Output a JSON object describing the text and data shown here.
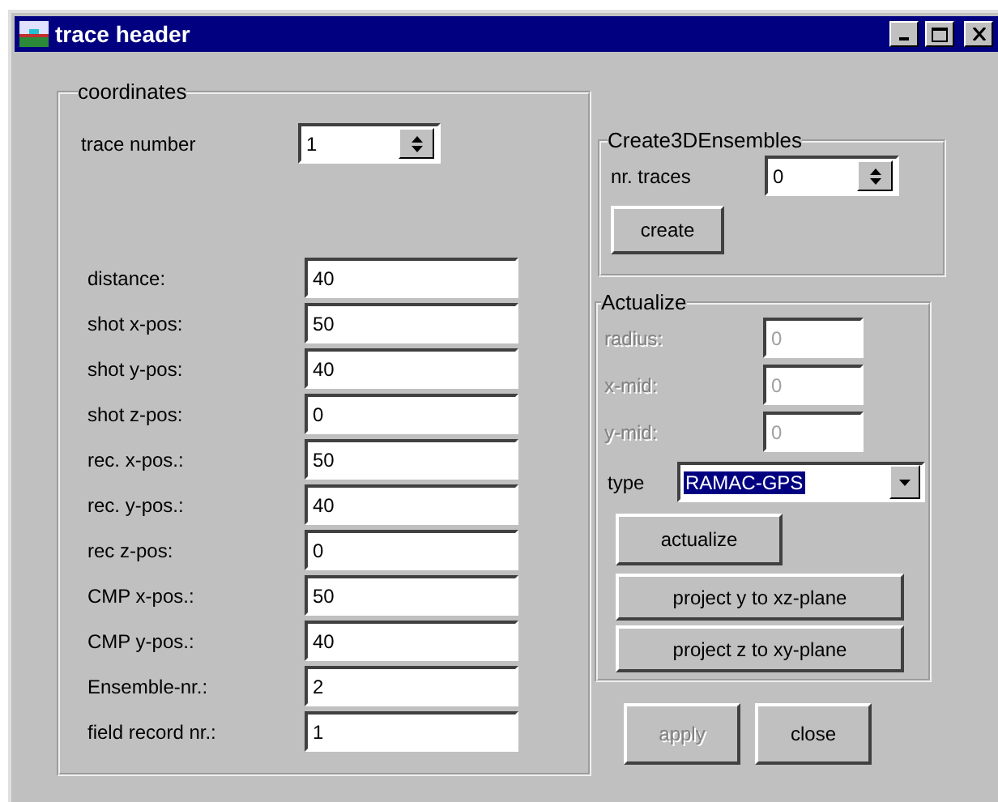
{
  "window": {
    "title": "trace header"
  },
  "coordinates": {
    "title": "coordinates",
    "trace_number": {
      "label": "trace number",
      "value": "1"
    },
    "fields": [
      {
        "label": "distance:",
        "value": "40"
      },
      {
        "label": "shot x-pos:",
        "value": "50"
      },
      {
        "label": "shot y-pos:",
        "value": "40"
      },
      {
        "label": "shot z-pos:",
        "value": "0"
      },
      {
        "label": "rec. x-pos.:",
        "value": "50"
      },
      {
        "label": "rec. y-pos.:",
        "value": "40"
      },
      {
        "label": "rec z-pos:",
        "value": "0"
      },
      {
        "label": "CMP x-pos.:",
        "value": "50"
      },
      {
        "label": "CMP y-pos.:",
        "value": "40"
      },
      {
        "label": "Ensemble-nr.:",
        "value": "2"
      },
      {
        "label": "field record nr.:",
        "value": "1"
      }
    ]
  },
  "create3d": {
    "title": "Create3DEnsembles",
    "nr_traces": {
      "label": "nr. traces",
      "value": "0"
    },
    "button": "create"
  },
  "actualize": {
    "title": "Actualize",
    "fields": [
      {
        "label": "radius:",
        "value": "0",
        "disabled": true
      },
      {
        "label": "x-mid:",
        "value": "0",
        "disabled": true
      },
      {
        "label": "y-mid:",
        "value": "0",
        "disabled": true
      }
    ],
    "type": {
      "label": "type",
      "value": "RAMAC-GPS",
      "highlighted": true
    },
    "buttons": [
      "actualize",
      "project y to xz-plane",
      "project z to xy-plane"
    ]
  },
  "footer_buttons": [
    {
      "label": "apply",
      "disabled": true
    },
    {
      "label": "close",
      "disabled": false
    }
  ]
}
